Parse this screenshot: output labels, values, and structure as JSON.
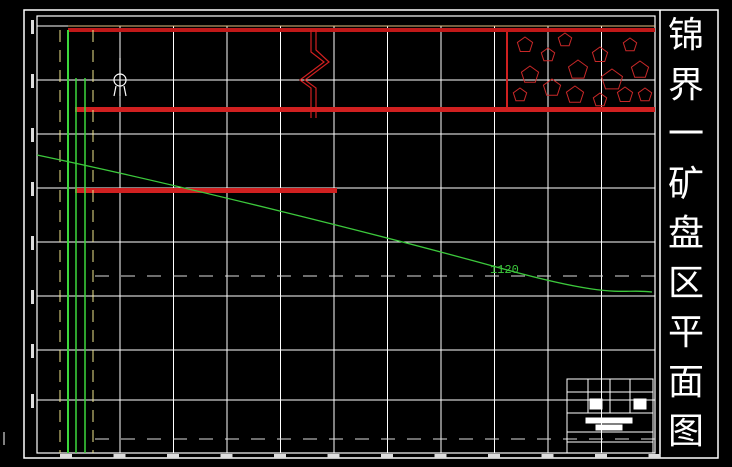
{
  "drawing": {
    "title_chars": [
      "锦",
      "界",
      "一",
      "矿",
      "盘",
      "区",
      "平",
      "面",
      "图"
    ],
    "title": "锦界一矿盘区平面图",
    "contour_label": "1120",
    "colors": {
      "background": "#000000",
      "grid": "#ffffff",
      "roadway": "#e02020",
      "contour": "#3cc83c",
      "dashed": "#f0e68c"
    }
  }
}
